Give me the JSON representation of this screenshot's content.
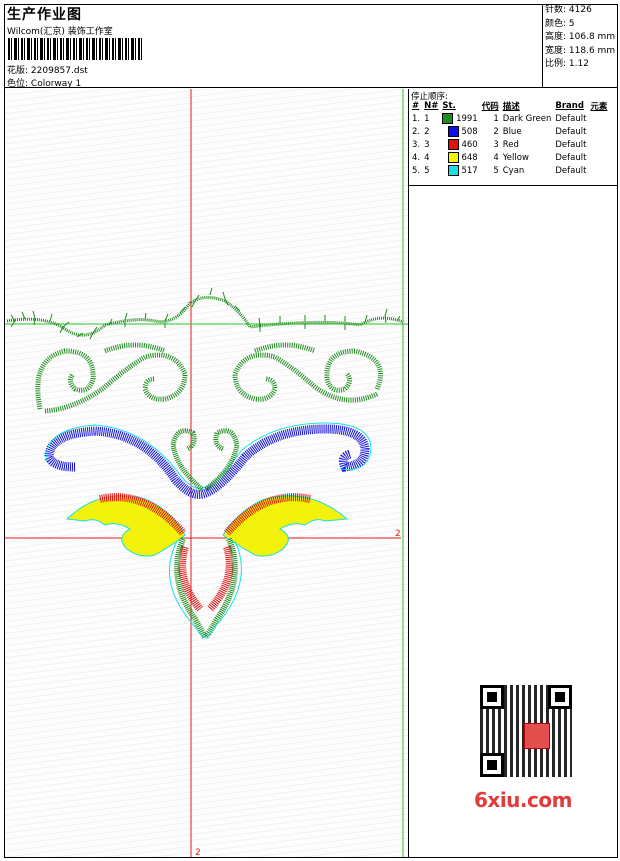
{
  "header": {
    "title": "生产作业图",
    "company": "Wilcom(汇京) 装饰工作室",
    "design_label": "花版:",
    "design_value": "2209857.dst",
    "colorway_label": "色位:",
    "colorway_value": "Colorway 1"
  },
  "stats": {
    "stitches_label": "针数:",
    "stitches": "4126",
    "colors_label": "颜色:",
    "colors": "5",
    "height_label": "高度:",
    "height": "106.8 mm",
    "width_label": "宽度:",
    "width": "118.6 mm",
    "scale_label": "比例:",
    "scale": "1.12"
  },
  "stop_sequence": {
    "title": "停止顺序:",
    "headers": [
      "#",
      "N#",
      "St.",
      "代码",
      "描述",
      "Brand",
      "元素"
    ],
    "rows": [
      {
        "num": "1.",
        "n": "1",
        "color": "#1e8c1e",
        "stitches": "1991",
        "code": "1",
        "desc": "Dark Green",
        "brand": "Default"
      },
      {
        "num": "2.",
        "n": "2",
        "color": "#1010e6",
        "stitches": "508",
        "code": "2",
        "desc": "Blue",
        "brand": "Default"
      },
      {
        "num": "3.",
        "n": "3",
        "color": "#e31010",
        "stitches": "460",
        "code": "3",
        "desc": "Red",
        "brand": "Default"
      },
      {
        "num": "4.",
        "n": "4",
        "color": "#f2f20a",
        "stitches": "648",
        "code": "4",
        "desc": "Yellow",
        "brand": "Default"
      },
      {
        "num": "5.",
        "n": "5",
        "color": "#15e1e6",
        "stitches": "517",
        "code": "5",
        "desc": "Cyan",
        "brand": "Default"
      }
    ]
  },
  "canvas": {
    "axis_label_h": "2",
    "axis_label_v": "2",
    "guide_color_red": "#e31b1b",
    "guide_color_green": "#27c427"
  },
  "watermark": "6xiu.com"
}
